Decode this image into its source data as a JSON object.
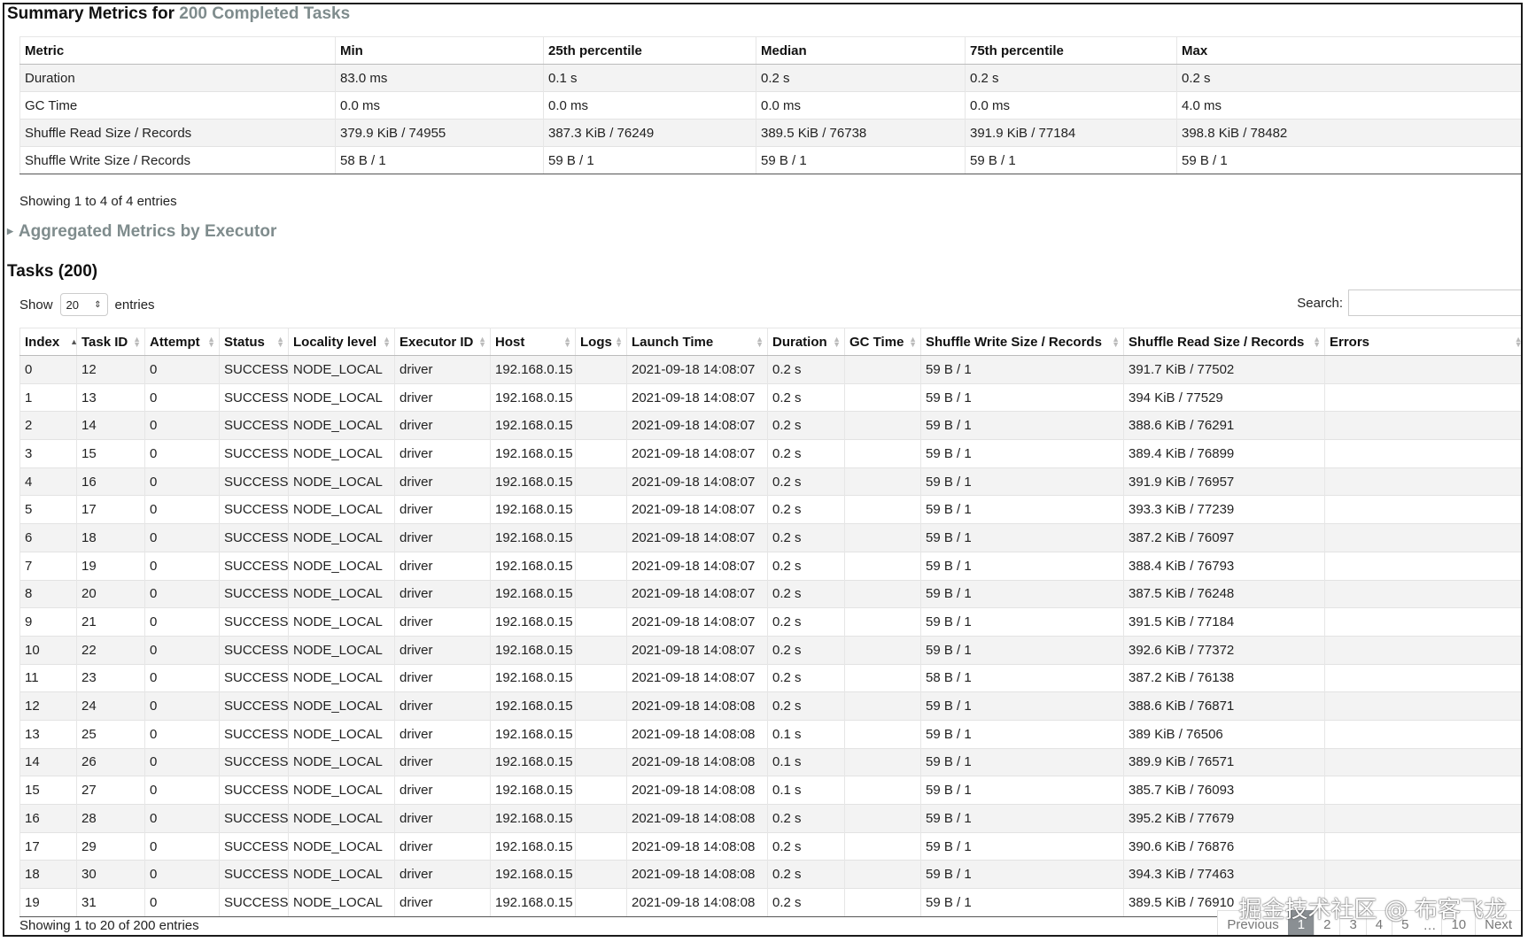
{
  "summary": {
    "title_prefix": "Summary Metrics for",
    "title_accent": "200 Completed Tasks",
    "headers": [
      "Metric",
      "Min",
      "25th percentile",
      "Median",
      "75th percentile",
      "Max"
    ],
    "rows": [
      [
        "Duration",
        "83.0 ms",
        "0.1 s",
        "0.2 s",
        "0.2 s",
        "0.2 s"
      ],
      [
        "GC Time",
        "0.0 ms",
        "0.0 ms",
        "0.0 ms",
        "0.0 ms",
        "4.0 ms"
      ],
      [
        "Shuffle Read Size / Records",
        "379.9 KiB / 74955",
        "387.3 KiB / 76249",
        "389.5 KiB / 76738",
        "391.9 KiB / 77184",
        "398.8 KiB / 78482"
      ],
      [
        "Shuffle Write Size / Records",
        "58 B / 1",
        "59 B / 1",
        "59 B / 1",
        "59 B / 1",
        "59 B / 1"
      ]
    ],
    "info": "Showing 1 to 4 of 4 entries"
  },
  "aggregated": {
    "title": "Aggregated Metrics by Executor"
  },
  "tasks": {
    "title": "Tasks (200)",
    "show_label": "Show",
    "show_value": "20",
    "entries_label": "entries",
    "search_label": "Search:",
    "headers": [
      "Index",
      "Task ID",
      "Attempt",
      "Status",
      "Locality level",
      "Executor ID",
      "Host",
      "Logs",
      "Launch Time",
      "Duration",
      "GC Time",
      "Shuffle Write Size / Records",
      "Shuffle Read Size / Records",
      "Errors"
    ],
    "rows": [
      [
        "0",
        "12",
        "0",
        "SUCCESS",
        "NODE_LOCAL",
        "driver",
        "192.168.0.15",
        "",
        "2021-09-18 14:08:07",
        "0.2 s",
        "",
        "59 B / 1",
        "391.7 KiB / 77502",
        ""
      ],
      [
        "1",
        "13",
        "0",
        "SUCCESS",
        "NODE_LOCAL",
        "driver",
        "192.168.0.15",
        "",
        "2021-09-18 14:08:07",
        "0.2 s",
        "",
        "59 B / 1",
        "394 KiB / 77529",
        ""
      ],
      [
        "2",
        "14",
        "0",
        "SUCCESS",
        "NODE_LOCAL",
        "driver",
        "192.168.0.15",
        "",
        "2021-09-18 14:08:07",
        "0.2 s",
        "",
        "59 B / 1",
        "388.6 KiB / 76291",
        ""
      ],
      [
        "3",
        "15",
        "0",
        "SUCCESS",
        "NODE_LOCAL",
        "driver",
        "192.168.0.15",
        "",
        "2021-09-18 14:08:07",
        "0.2 s",
        "",
        "59 B / 1",
        "389.4 KiB / 76899",
        ""
      ],
      [
        "4",
        "16",
        "0",
        "SUCCESS",
        "NODE_LOCAL",
        "driver",
        "192.168.0.15",
        "",
        "2021-09-18 14:08:07",
        "0.2 s",
        "",
        "59 B / 1",
        "391.9 KiB / 76957",
        ""
      ],
      [
        "5",
        "17",
        "0",
        "SUCCESS",
        "NODE_LOCAL",
        "driver",
        "192.168.0.15",
        "",
        "2021-09-18 14:08:07",
        "0.2 s",
        "",
        "59 B / 1",
        "393.3 KiB / 77239",
        ""
      ],
      [
        "6",
        "18",
        "0",
        "SUCCESS",
        "NODE_LOCAL",
        "driver",
        "192.168.0.15",
        "",
        "2021-09-18 14:08:07",
        "0.2 s",
        "",
        "59 B / 1",
        "387.2 KiB / 76097",
        ""
      ],
      [
        "7",
        "19",
        "0",
        "SUCCESS",
        "NODE_LOCAL",
        "driver",
        "192.168.0.15",
        "",
        "2021-09-18 14:08:07",
        "0.2 s",
        "",
        "59 B / 1",
        "388.4 KiB / 76793",
        ""
      ],
      [
        "8",
        "20",
        "0",
        "SUCCESS",
        "NODE_LOCAL",
        "driver",
        "192.168.0.15",
        "",
        "2021-09-18 14:08:07",
        "0.2 s",
        "",
        "59 B / 1",
        "387.5 KiB / 76248",
        ""
      ],
      [
        "9",
        "21",
        "0",
        "SUCCESS",
        "NODE_LOCAL",
        "driver",
        "192.168.0.15",
        "",
        "2021-09-18 14:08:07",
        "0.2 s",
        "",
        "59 B / 1",
        "391.5 KiB / 77184",
        ""
      ],
      [
        "10",
        "22",
        "0",
        "SUCCESS",
        "NODE_LOCAL",
        "driver",
        "192.168.0.15",
        "",
        "2021-09-18 14:08:07",
        "0.2 s",
        "",
        "59 B / 1",
        "392.6 KiB / 77372",
        ""
      ],
      [
        "11",
        "23",
        "0",
        "SUCCESS",
        "NODE_LOCAL",
        "driver",
        "192.168.0.15",
        "",
        "2021-09-18 14:08:07",
        "0.2 s",
        "",
        "58 B / 1",
        "387.2 KiB / 76138",
        ""
      ],
      [
        "12",
        "24",
        "0",
        "SUCCESS",
        "NODE_LOCAL",
        "driver",
        "192.168.0.15",
        "",
        "2021-09-18 14:08:08",
        "0.2 s",
        "",
        "59 B / 1",
        "388.6 KiB / 76871",
        ""
      ],
      [
        "13",
        "25",
        "0",
        "SUCCESS",
        "NODE_LOCAL",
        "driver",
        "192.168.0.15",
        "",
        "2021-09-18 14:08:08",
        "0.1 s",
        "",
        "59 B / 1",
        "389 KiB / 76506",
        ""
      ],
      [
        "14",
        "26",
        "0",
        "SUCCESS",
        "NODE_LOCAL",
        "driver",
        "192.168.0.15",
        "",
        "2021-09-18 14:08:08",
        "0.1 s",
        "",
        "59 B / 1",
        "389.9 KiB / 76571",
        ""
      ],
      [
        "15",
        "27",
        "0",
        "SUCCESS",
        "NODE_LOCAL",
        "driver",
        "192.168.0.15",
        "",
        "2021-09-18 14:08:08",
        "0.1 s",
        "",
        "59 B / 1",
        "385.7 KiB / 76093",
        ""
      ],
      [
        "16",
        "28",
        "0",
        "SUCCESS",
        "NODE_LOCAL",
        "driver",
        "192.168.0.15",
        "",
        "2021-09-18 14:08:08",
        "0.2 s",
        "",
        "59 B / 1",
        "395.2 KiB / 77679",
        ""
      ],
      [
        "17",
        "29",
        "0",
        "SUCCESS",
        "NODE_LOCAL",
        "driver",
        "192.168.0.15",
        "",
        "2021-09-18 14:08:08",
        "0.2 s",
        "",
        "59 B / 1",
        "390.6 KiB / 76876",
        ""
      ],
      [
        "18",
        "30",
        "0",
        "SUCCESS",
        "NODE_LOCAL",
        "driver",
        "192.168.0.15",
        "",
        "2021-09-18 14:08:08",
        "0.2 s",
        "",
        "59 B / 1",
        "394.3 KiB / 77463",
        ""
      ],
      [
        "19",
        "31",
        "0",
        "SUCCESS",
        "NODE_LOCAL",
        "driver",
        "192.168.0.15",
        "",
        "2021-09-18 14:08:08",
        "0.2 s",
        "",
        "59 B / 1",
        "389.5 KiB / 76910",
        ""
      ]
    ],
    "info": "Showing 1 to 20 of 200 entries"
  },
  "pagination": {
    "previous": "Previous",
    "pages": [
      "1",
      "2",
      "3",
      "4",
      "5"
    ],
    "ellipsis": "…",
    "last": "10",
    "next": "Next",
    "active_page": "1"
  },
  "watermark": "掘金技术社区 @ 布客飞龙",
  "colors": {
    "accent_gray": "#7f8c8d",
    "stripe": "#f3f3f3",
    "active_page": "#8a8f93"
  }
}
